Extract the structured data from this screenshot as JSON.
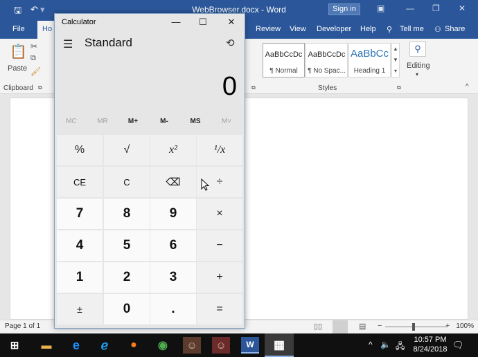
{
  "word": {
    "doc_title": "WebBrowser.docx - Word",
    "signin": "Sign in",
    "tabs": {
      "file": "File",
      "home": "Ho",
      "review": "Review",
      "view": "View",
      "developer": "Developer",
      "help": "Help",
      "tellme": "Tell me",
      "share": "Share"
    },
    "ribbon": {
      "paste": "Paste",
      "clipboard": "Clipboard",
      "styles_group": "Styles",
      "editing": "Editing",
      "styles": [
        {
          "sample": "AaBbCcDc",
          "name": "¶ Normal"
        },
        {
          "sample": "AaBbCcDc",
          "name": "¶ No Spac..."
        },
        {
          "sample": "AaBbCc",
          "name": "Heading 1"
        }
      ]
    },
    "status": {
      "page": "Page 1 of 1",
      "zoom": "100%"
    }
  },
  "calculator": {
    "title": "Calculator",
    "mode": "Standard",
    "display": "0",
    "memory": [
      "MC",
      "MR",
      "M+",
      "M-",
      "MS",
      "M˅"
    ],
    "keys": [
      [
        "%",
        "√",
        "x²",
        "¹/x"
      ],
      [
        "CE",
        "C",
        "⌫",
        "÷"
      ],
      [
        "7",
        "8",
        "9",
        "×"
      ],
      [
        "4",
        "5",
        "6",
        "−"
      ],
      [
        "1",
        "2",
        "3",
        "+"
      ],
      [
        "±",
        "0",
        ".",
        "="
      ]
    ]
  },
  "taskbar": {
    "time": "10:57 PM",
    "date": "8/24/2018"
  },
  "colors": {
    "word_blue": "#2b579a",
    "calc_bg": "#e6e6e6",
    "taskbar": "#101010"
  }
}
